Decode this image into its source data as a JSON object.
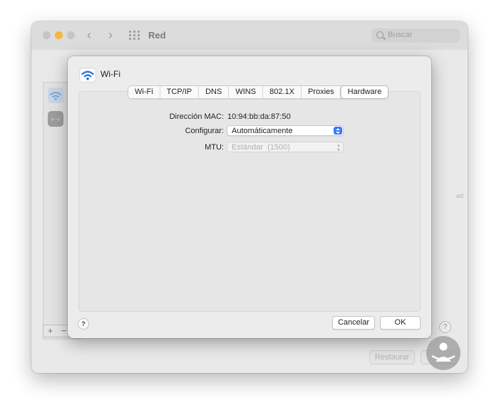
{
  "window": {
    "title": "Red",
    "search_placeholder": "Buscar",
    "revert_label": "Restaurar",
    "sidebar_fragment": "ad",
    "add_symbol": "+",
    "remove_symbol": "−",
    "help_symbol": "?"
  },
  "sheet": {
    "interface_name": "Wi-Fi",
    "tabs": [
      {
        "label": "Wi-Fi"
      },
      {
        "label": "TCP/IP"
      },
      {
        "label": "DNS"
      },
      {
        "label": "WINS"
      },
      {
        "label": "802.1X"
      },
      {
        "label": "Proxies"
      },
      {
        "label": "Hardware",
        "active": true
      }
    ],
    "mac_label": "Dirección MAC:",
    "mac_value": "10:94:bb:da:87:50",
    "configure_label": "Configurar:",
    "configure_value": "Automáticamente",
    "mtu_label": "MTU:",
    "mtu_value": "Estándar  (1500)",
    "help_symbol": "?",
    "cancel_label": "Cancelar",
    "ok_label": "OK"
  },
  "colors": {
    "accent": "#3478f6",
    "wifi_icon": "#1f6fe0",
    "traffic_minimize": "#f5b83d",
    "watermark": "#9a9a9a"
  },
  "icons": [
    "wifi-icon",
    "network-other-icon",
    "search-icon",
    "grid-icon",
    "chevron-left-icon",
    "chevron-right-icon",
    "updown-stepper-icon",
    "help-icon",
    "watermark-logo-icon"
  ]
}
